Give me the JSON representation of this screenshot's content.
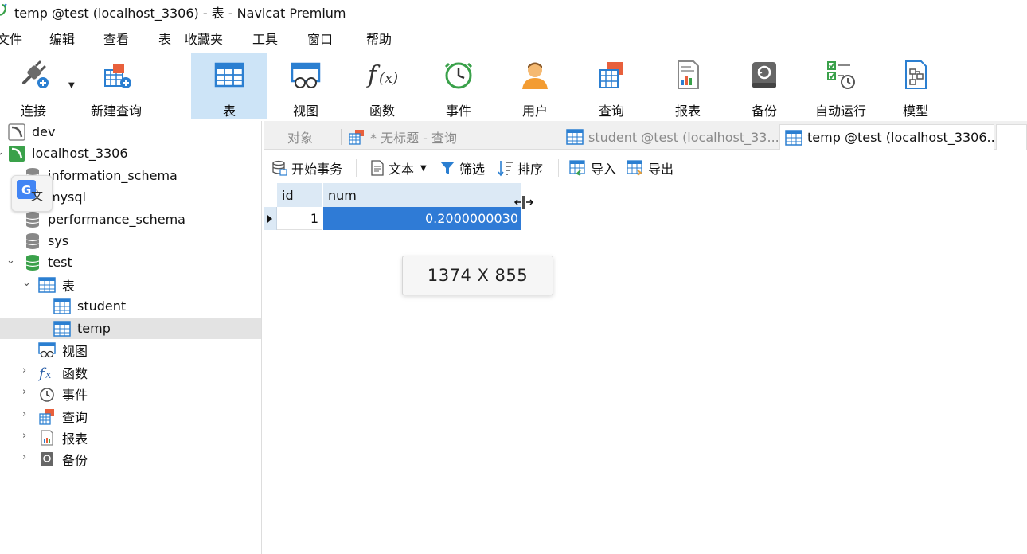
{
  "window": {
    "title": "temp @test (localhost_3306) - 表 - Navicat Premium"
  },
  "menu": [
    "文件",
    "编辑",
    "查看",
    "表",
    "收藏夹",
    "工具",
    "窗口",
    "帮助"
  ],
  "toolbar": {
    "connect": "连接",
    "new_query": "新建查询",
    "table": "表",
    "view": "视图",
    "function": "函数",
    "event": "事件",
    "user": "用户",
    "query": "查询",
    "report": "报表",
    "backup": "备份",
    "automation": "自动运行",
    "model": "模型"
  },
  "tree": {
    "dev": "dev",
    "localhost": "localhost_3306",
    "information_schema": "information_schema",
    "mysql": "mysql",
    "performance_schema": "performance_schema",
    "sys": "sys",
    "test": "test",
    "tables": "表",
    "student": "student",
    "temp": "temp",
    "views": "视图",
    "functions": "函数",
    "events": "事件",
    "queries": "查询",
    "reports": "报表",
    "backups": "备份"
  },
  "translate_badge": {
    "letter": "G",
    "text": "文"
  },
  "tabs": {
    "objects": "对象",
    "untitled_query": "* 无标题 - 查询",
    "student": "student @test (localhost_33...",
    "temp": "temp @test (localhost_3306..."
  },
  "subtoolbar": {
    "begin_transaction": "开始事务",
    "text": "文本",
    "filter": "筛选",
    "sort": "排序",
    "import": "导入",
    "export": "导出"
  },
  "grid": {
    "columns": [
      "id",
      "num"
    ],
    "rows": [
      {
        "id": "1",
        "num": "0.2000000030"
      }
    ]
  },
  "size_tooltip": "1374 X 855",
  "colors": {
    "selected_cell": "#2f7bd6",
    "header_bg": "#dce9f5",
    "active_tool": "#cde4f7"
  }
}
